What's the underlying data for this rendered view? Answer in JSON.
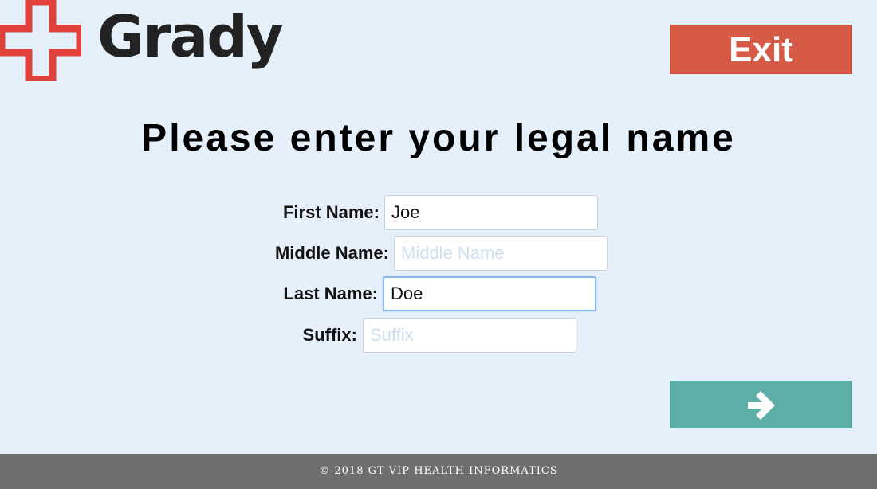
{
  "header": {
    "logo_text": "Grady",
    "logo_icon": "red-cross-icon",
    "exit_label": "Exit"
  },
  "colors": {
    "background": "#e6f0fb",
    "exit_button": "#d65a45",
    "next_button": "#5eaea8",
    "logo_cross": "#e0413a",
    "footer": "#6f6f6f"
  },
  "main": {
    "title": "Please enter your legal name",
    "fields": {
      "first_name": {
        "label": "First Name:",
        "value": "Joe",
        "placeholder": ""
      },
      "middle_name": {
        "label": "Middle Name:",
        "value": "",
        "placeholder": "Middle Name"
      },
      "last_name": {
        "label": "Last Name:",
        "value": "Doe",
        "placeholder": ""
      },
      "suffix": {
        "label": "Suffix:",
        "value": "",
        "placeholder": "Suffix"
      }
    },
    "next_icon": "arrow-right-icon"
  },
  "footer": {
    "text": "© 2018 GT VIP HEALTH INFORMATICS"
  }
}
